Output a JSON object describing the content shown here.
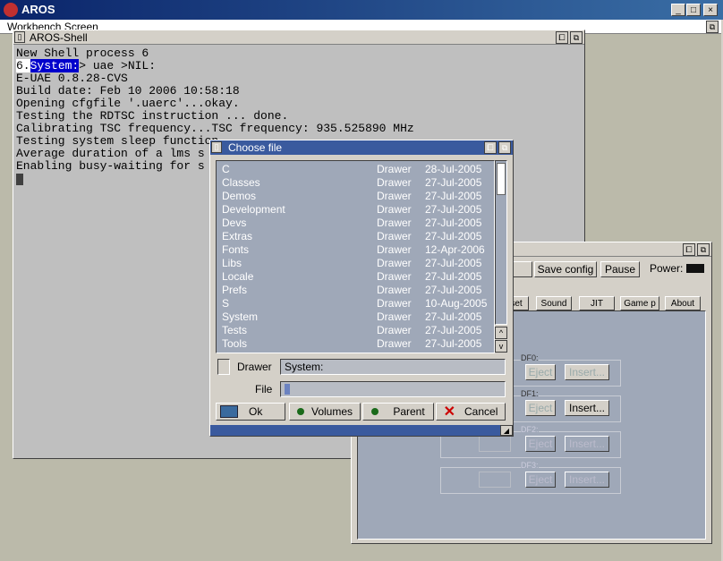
{
  "host_window": {
    "title": "AROS",
    "controls": [
      "_",
      "□",
      "×"
    ]
  },
  "screen": {
    "title": "Workbench Screen"
  },
  "shell": {
    "title": "AROS-Shell",
    "lines": [
      "New Shell process 6",
      "E-UAE 0.8.28-CVS",
      "Build date: Feb 10 2006 10:58:18",
      "Opening cfgfile '.uaerc'...okay.",
      "Testing the RDTSC instruction ... done.",
      "Calibrating TSC frequency...TSC frequency: 935.525890 MHz",
      "Testing system sleep function",
      "Average duration of a lms s",
      "Enabling busy-waiting for s"
    ],
    "prompt_num": "6.",
    "prompt_path": "System:",
    "prompt_cmd": "> uae >NIL:"
  },
  "uae": {
    "save_config": "Save config",
    "pause": "Pause",
    "power": "Power:",
    "tabs": [
      "set",
      "Sound",
      "JIT",
      "Game p",
      "About"
    ],
    "drives": [
      {
        "label": "DF0:",
        "eject": "Eject",
        "insert": "Insert...",
        "enabled": false
      },
      {
        "label": "DF1:",
        "eject": "Eject",
        "insert": "Insert...",
        "enabled": true
      },
      {
        "label": "DF2:",
        "eject": "Eject",
        "insert": "Insert...",
        "enabled": false
      },
      {
        "label": "DF3:",
        "eject": "Eject",
        "insert": "Insert...",
        "enabled": false
      }
    ]
  },
  "dialog": {
    "title": "Choose file",
    "files": [
      {
        "name": "C",
        "type": "Drawer",
        "date": "28-Jul-2005"
      },
      {
        "name": "Classes",
        "type": "Drawer",
        "date": "27-Jul-2005"
      },
      {
        "name": "Demos",
        "type": "Drawer",
        "date": "27-Jul-2005"
      },
      {
        "name": "Development",
        "type": "Drawer",
        "date": "27-Jul-2005"
      },
      {
        "name": "Devs",
        "type": "Drawer",
        "date": "27-Jul-2005"
      },
      {
        "name": "Extras",
        "type": "Drawer",
        "date": "27-Jul-2005"
      },
      {
        "name": "Fonts",
        "type": "Drawer",
        "date": "12-Apr-2006"
      },
      {
        "name": "Libs",
        "type": "Drawer",
        "date": "27-Jul-2005"
      },
      {
        "name": "Locale",
        "type": "Drawer",
        "date": "27-Jul-2005"
      },
      {
        "name": "Prefs",
        "type": "Drawer",
        "date": "27-Jul-2005"
      },
      {
        "name": "S",
        "type": "Drawer",
        "date": "10-Aug-2005"
      },
      {
        "name": "System",
        "type": "Drawer",
        "date": "27-Jul-2005"
      },
      {
        "name": "Tests",
        "type": "Drawer",
        "date": "27-Jul-2005"
      },
      {
        "name": "Tools",
        "type": "Drawer",
        "date": "27-Jul-2005"
      }
    ],
    "drawer_label": "Drawer",
    "drawer_value": "System:",
    "file_label": "File",
    "file_value": "",
    "ok": "Ok",
    "volumes": "Volumes",
    "parent": "Parent",
    "cancel": "Cancel"
  }
}
